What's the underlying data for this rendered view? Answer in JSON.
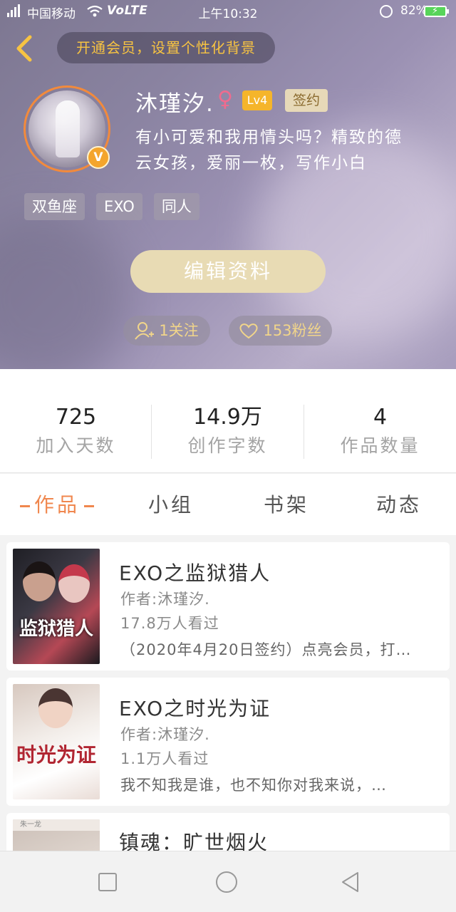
{
  "status_bar": {
    "carrier": "中国移动",
    "network": "4G",
    "volte": "VoLTE",
    "time": "上午10:32",
    "battery_pct": "82%"
  },
  "header": {
    "vip_promo": "开通会员，设置个性化背景",
    "nickname": "沐瑾汐.",
    "gender_symbol": "♀",
    "level": "Lv4",
    "sign_badge": "签约",
    "bio_line1": "有小可爱和我用情头吗？精致的德",
    "bio_line2": "云女孩，爱丽一枚，写作小白",
    "tags": [
      "双鱼座",
      "EXO",
      "同人"
    ],
    "edit_button": "编辑资料",
    "follow_label": "1关注",
    "fans_label": "153粉丝",
    "verified_mark": "V"
  },
  "stats": [
    {
      "value": "725",
      "label": "加入天数"
    },
    {
      "value": "14.9万",
      "label": "创作字数"
    },
    {
      "value": "4",
      "label": "作品数量"
    }
  ],
  "tabs": {
    "works": "作品",
    "groups": "小组",
    "bookshelf": "书架",
    "moments": "动态"
  },
  "works": [
    {
      "title": "EXO之监狱猎人",
      "author": "作者:沐瑾汐.",
      "views": "17.8万人看过",
      "desc": "（2020年4月20日签约）点亮会员，打…",
      "cover_text": "监狱猎人"
    },
    {
      "title": "EXO之时光为证",
      "author": "作者:沐瑾汐.",
      "views": "1.1万人看过",
      "desc": "我不知我是谁，也不知你对我来说，…",
      "cover_text": "时光为证"
    },
    {
      "title": "镇魂：旷世烟火",
      "cover_text": "朱一龙"
    }
  ],
  "colors": {
    "accent": "#f0874e",
    "gold": "#f7c342",
    "edit_button_bg": "#e8dbb4"
  }
}
